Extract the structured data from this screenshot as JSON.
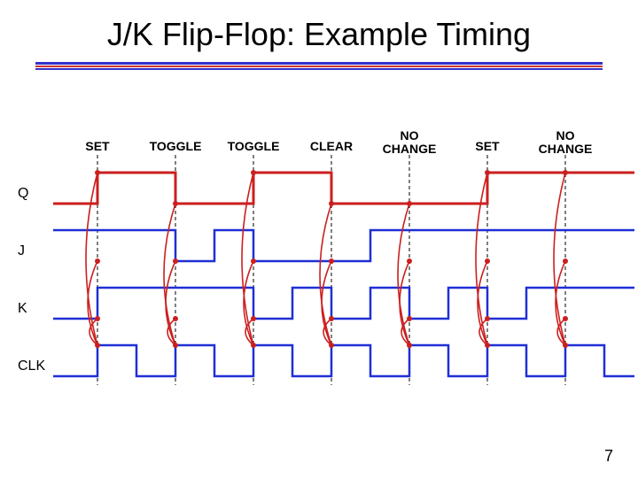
{
  "title": "J/K Flip-Flop: Example Timing",
  "page_number": "7",
  "colors": {
    "q_trace": "#cc1f1f",
    "jk_trace": "#1f2fd6",
    "clk_trace": "#1f2fd6",
    "edge_guide": "#000000",
    "arrow": "#cc1f1f"
  },
  "signals": {
    "Q": {
      "label": "Q"
    },
    "J": {
      "label": "J"
    },
    "K": {
      "label": "K"
    },
    "CLK": {
      "label": "CLK"
    }
  },
  "edge_labels": [
    "SET",
    "TOGGLE",
    "TOGGLE",
    "CLEAR",
    "NO\nCHANGE",
    "SET",
    "NO\nCHANGE"
  ],
  "chart_data": {
    "type": "timing-diagram",
    "clock_periods": 7,
    "rising_edges": [
      1,
      2,
      3,
      4,
      5,
      6,
      7
    ],
    "traces": {
      "CLK": {
        "period": 1,
        "duty": 0.5,
        "initial": 0
      },
      "J": {
        "initial": 1,
        "transitions_at_period": [
          [
            2,
            0
          ],
          [
            2.5,
            1
          ],
          [
            3,
            0
          ],
          [
            4.5,
            1
          ]
        ]
      },
      "K": {
        "initial": 0,
        "transitions_at_period": [
          [
            1,
            1
          ],
          [
            3,
            0
          ],
          [
            3.5,
            1
          ],
          [
            4,
            0
          ],
          [
            4.5,
            1
          ],
          [
            5,
            0
          ],
          [
            5.5,
            1
          ],
          [
            6,
            0
          ],
          [
            6.5,
            1
          ]
        ]
      },
      "Q": {
        "initial": 0,
        "values_after_edge": [
          1,
          0,
          1,
          0,
          0,
          1,
          1
        ]
      }
    },
    "edge_actions": [
      "SET",
      "TOGGLE",
      "TOGGLE",
      "CLEAR",
      "NO CHANGE",
      "SET",
      "NO CHANGE"
    ]
  }
}
